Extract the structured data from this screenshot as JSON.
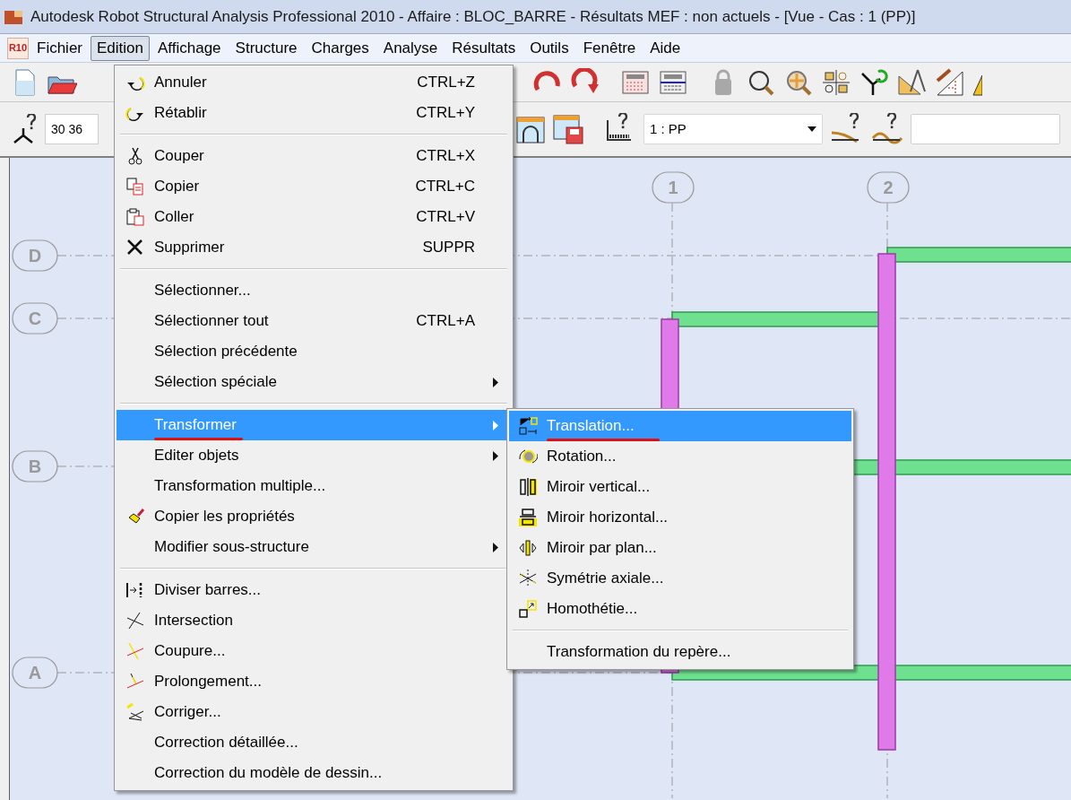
{
  "window": {
    "title": "Autodesk Robot Structural Analysis Professional 2010 - Affaire : BLOC_BARRE - Résultats MEF : non actuels - [Vue - Cas : 1 (PP)]",
    "app_logo": "R10"
  },
  "menu_bar": [
    {
      "label": "Fichier",
      "selected": false
    },
    {
      "label": "Edition",
      "selected": true
    },
    {
      "label": "Affichage",
      "selected": false
    },
    {
      "label": "Structure",
      "selected": false
    },
    {
      "label": "Charges",
      "selected": false
    },
    {
      "label": "Analyse",
      "selected": false
    },
    {
      "label": "Résultats",
      "selected": false
    },
    {
      "label": "Outils",
      "selected": false
    },
    {
      "label": "Fenêtre",
      "selected": false
    },
    {
      "label": "Aide",
      "selected": false
    }
  ],
  "toolbar": {
    "coordinate_field": "30 36",
    "case_dropdown": "1 : PP"
  },
  "edition_menu": [
    {
      "kind": "item",
      "label": "Annuler",
      "shortcut": "CTRL+Z",
      "submenu": false,
      "selected": false,
      "annotated": false
    },
    {
      "kind": "item",
      "label": "Rétablir",
      "shortcut": "CTRL+Y",
      "submenu": false,
      "selected": false,
      "annotated": false
    },
    {
      "kind": "separator"
    },
    {
      "kind": "item",
      "label": "Couper",
      "shortcut": "CTRL+X",
      "submenu": false,
      "selected": false,
      "annotated": false
    },
    {
      "kind": "item",
      "label": "Copier",
      "shortcut": "CTRL+C",
      "submenu": false,
      "selected": false,
      "annotated": false
    },
    {
      "kind": "item",
      "label": "Coller",
      "shortcut": "CTRL+V",
      "submenu": false,
      "selected": false,
      "annotated": false
    },
    {
      "kind": "item",
      "label": "Supprimer",
      "shortcut": "SUPPR",
      "submenu": false,
      "selected": false,
      "annotated": false
    },
    {
      "kind": "separator"
    },
    {
      "kind": "item",
      "label": "Sélectionner...",
      "submenu": false,
      "selected": false,
      "annotated": false
    },
    {
      "kind": "item",
      "label": "Sélectionner tout",
      "shortcut": "CTRL+A",
      "submenu": false,
      "selected": false,
      "annotated": false
    },
    {
      "kind": "item",
      "label": "Sélection précédente",
      "submenu": false,
      "selected": false,
      "annotated": false
    },
    {
      "kind": "item",
      "label": "Sélection spéciale",
      "submenu": true,
      "selected": false,
      "annotated": false
    },
    {
      "kind": "separator"
    },
    {
      "kind": "item",
      "label": "Transformer",
      "submenu": true,
      "selected": true,
      "annotated": true
    },
    {
      "kind": "item",
      "label": "Editer objets",
      "submenu": true,
      "selected": false,
      "annotated": false
    },
    {
      "kind": "item",
      "label": "Transformation multiple...",
      "submenu": false,
      "selected": false,
      "annotated": false
    },
    {
      "kind": "item",
      "label": "Copier les propriétés",
      "submenu": false,
      "selected": false,
      "annotated": false
    },
    {
      "kind": "item",
      "label": "Modifier sous-structure",
      "submenu": true,
      "selected": false,
      "annotated": false
    },
    {
      "kind": "separator"
    },
    {
      "kind": "item",
      "label": "Diviser barres...",
      "submenu": false,
      "selected": false,
      "annotated": false
    },
    {
      "kind": "item",
      "label": "Intersection",
      "submenu": false,
      "selected": false,
      "annotated": false
    },
    {
      "kind": "item",
      "label": "Coupure...",
      "submenu": false,
      "selected": false,
      "annotated": false
    },
    {
      "kind": "item",
      "label": "Prolongement...",
      "submenu": false,
      "selected": false,
      "annotated": false
    },
    {
      "kind": "item",
      "label": "Corriger...",
      "submenu": false,
      "selected": false,
      "annotated": false
    },
    {
      "kind": "item",
      "label": "Correction détaillée...",
      "submenu": false,
      "selected": false,
      "annotated": false
    },
    {
      "kind": "item",
      "label": "Correction du modèle de dessin...",
      "submenu": false,
      "selected": false,
      "annotated": false
    }
  ],
  "transformer_submenu": [
    {
      "kind": "item",
      "label": "Translation...",
      "selected": true,
      "annotated": true
    },
    {
      "kind": "item",
      "label": "Rotation...",
      "selected": false,
      "annotated": false
    },
    {
      "kind": "item",
      "label": "Miroir vertical...",
      "selected": false,
      "annotated": false
    },
    {
      "kind": "item",
      "label": "Miroir horizontal...",
      "selected": false,
      "annotated": false
    },
    {
      "kind": "item",
      "label": "Miroir par plan...",
      "selected": false,
      "annotated": false
    },
    {
      "kind": "item",
      "label": "Symétrie axiale...",
      "selected": false,
      "annotated": false
    },
    {
      "kind": "item",
      "label": "Homothétie...",
      "selected": false,
      "annotated": false
    },
    {
      "kind": "separator"
    },
    {
      "kind": "item",
      "label": "Transformation du repère...",
      "selected": false,
      "annotated": false
    }
  ],
  "canvas": {
    "row_axes": [
      "D",
      "C",
      "B",
      "A"
    ],
    "column_axes": [
      "1",
      "2"
    ]
  }
}
